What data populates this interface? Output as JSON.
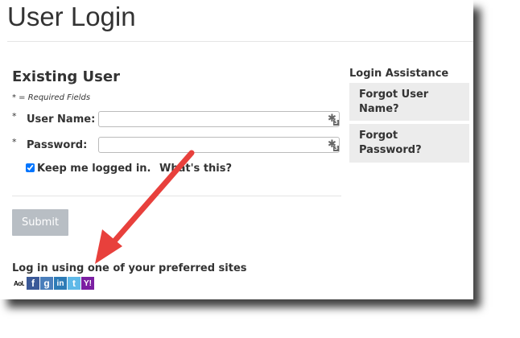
{
  "page": {
    "title": "User Login"
  },
  "existing_user": {
    "heading": "Existing User",
    "required_note": "* = Required Fields",
    "username": {
      "star": "*",
      "label": "User Name:",
      "value": ""
    },
    "password": {
      "star": "*",
      "label": "Password:",
      "value": ""
    },
    "password_manager_badge": "3",
    "keep_logged_in": {
      "label": "Keep me logged in.",
      "link": "What's this?",
      "checked": true
    },
    "submit_label": "Submit"
  },
  "social": {
    "title": "Log in using one of your preferred sites",
    "icons": [
      {
        "name": "aol-icon",
        "glyph": "Aol.",
        "color": "#ffffff"
      },
      {
        "name": "facebook-icon",
        "glyph": "f",
        "color": "#3b5998"
      },
      {
        "name": "google-icon",
        "glyph": "g",
        "color": "#4a7ebb"
      },
      {
        "name": "linkedin-icon",
        "glyph": "in",
        "color": "#2d7bb6"
      },
      {
        "name": "twitter-icon",
        "glyph": "t",
        "color": "#5fb9e8"
      },
      {
        "name": "yahoo-icon",
        "glyph": "Y!",
        "color": "#7b1fa2"
      }
    ]
  },
  "assistance": {
    "title": "Login Assistance",
    "forgot_username": "Forgot User Name?",
    "forgot_password": "Forgot Password?"
  },
  "colors": {
    "arrow": "#e8403c",
    "submit_bg": "#b8bec4",
    "assist_bg": "#ececec"
  }
}
